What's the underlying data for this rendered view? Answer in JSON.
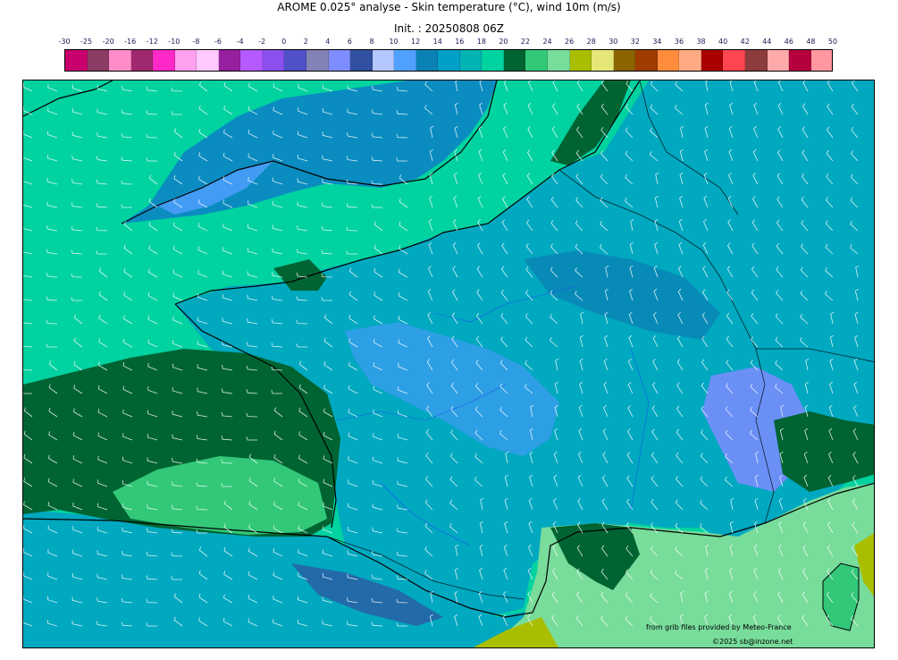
{
  "title": "AROME 0.025° analyse - Skin temperature (°C), wind 10m (m/s)",
  "init": "Init. : 20250808 06Z",
  "colorbar": {
    "ticks": [
      "-30",
      "-25",
      "-20",
      "-16",
      "-12",
      "-10",
      "-8",
      "-6",
      "-4",
      "-2",
      "0",
      "2",
      "4",
      "6",
      "8",
      "10",
      "12",
      "14",
      "16",
      "18",
      "20",
      "22",
      "24",
      "26",
      "28",
      "30",
      "32",
      "34",
      "36",
      "38",
      "40",
      "42",
      "44",
      "46",
      "48",
      "50"
    ],
    "colors": [
      "#c8006e",
      "#8c3c64",
      "#ff8cc8",
      "#a0286e",
      "#ff28c8",
      "#ffa0f0",
      "#ffc8ff",
      "#9620a0",
      "#b45aff",
      "#8c50f0",
      "#5050c8",
      "#8282b4",
      "#7d8cff",
      "#3250a0",
      "#b4c8ff",
      "#50a0ff",
      "#0a82b4",
      "#00a0c8",
      "#00b4b4",
      "#00d2a0",
      "#006432",
      "#32c878",
      "#78dc9b",
      "#aabe00",
      "#e6e678",
      "#8c6400",
      "#a03c00",
      "#ff8c3c",
      "#ffaa82",
      "#aa0000",
      "#ff4650",
      "#8c3c3c",
      "#ffaaaa",
      "#b4003c",
      "#ff96a0"
    ]
  },
  "credits": {
    "source": "from grib files provided by Meteo-France",
    "copyright": "©2025 sb@inzone.net"
  }
}
